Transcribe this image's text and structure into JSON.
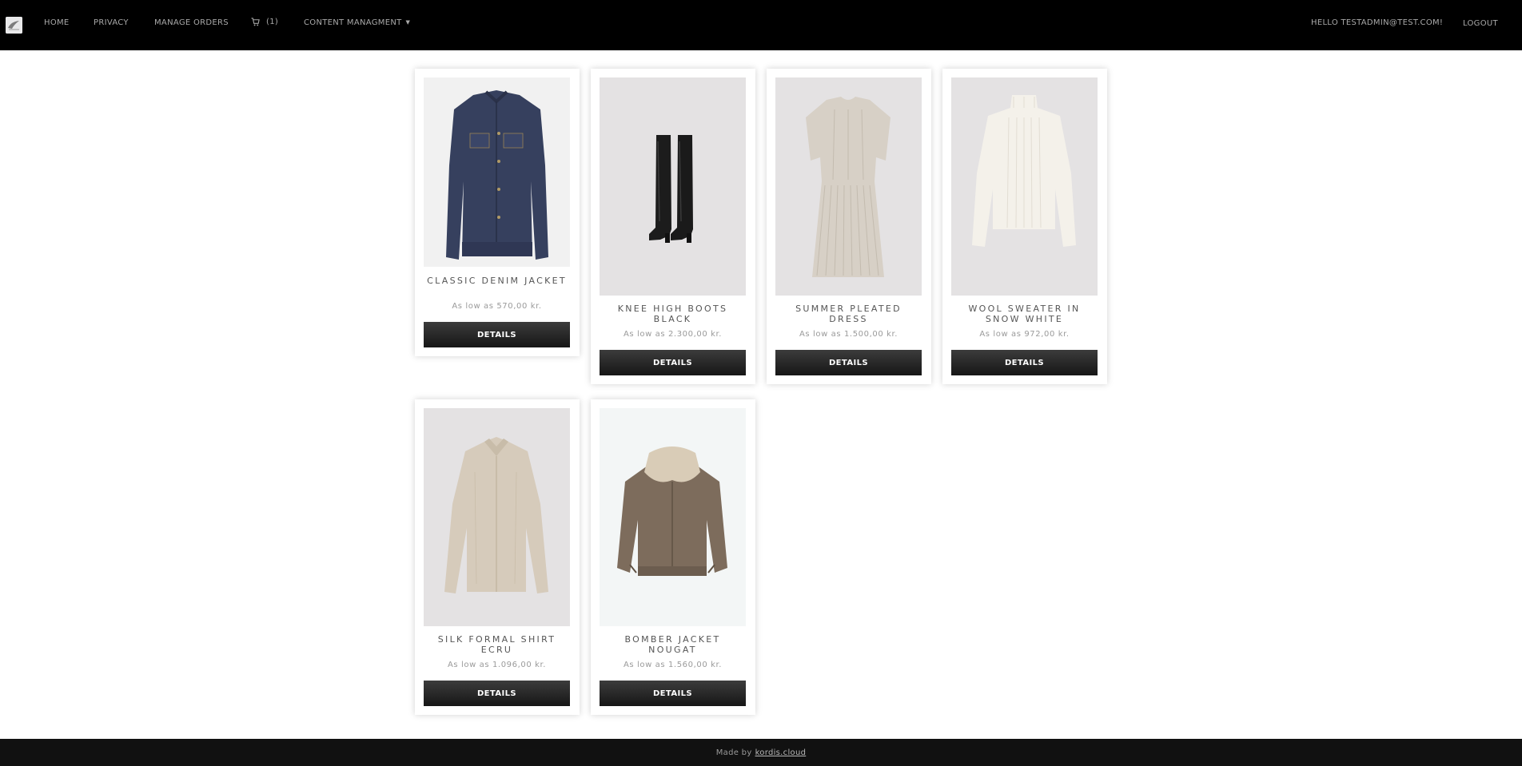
{
  "nav": {
    "logo_icon": "brand-logo-icon",
    "home": "HOME",
    "privacy": "PRIVACY",
    "manage_orders": "MANAGE ORDERS",
    "cart_icon": "cart-icon",
    "cart_count": "(1)",
    "content_management": "CONTENT MANAGMENT",
    "greeting": "HELLO TESTADMIN@TEST.COM!",
    "logout": "LOGOUT"
  },
  "products": [
    {
      "name": "CLASSIC DENIM JACKET",
      "price": "As low as 570,00 kr.",
      "button": "DETAILS",
      "image": "denim-jacket-image"
    },
    {
      "name": "KNEE HIGH BOOTS BLACK",
      "price": "As low as 2.300,00 kr.",
      "button": "DETAILS",
      "image": "knee-high-boots-image"
    },
    {
      "name": "SUMMER PLEATED DRESS",
      "price": "As low as 1.500,00 kr.",
      "button": "DETAILS",
      "image": "pleated-dress-image"
    },
    {
      "name": "WOOL SWEATER IN SNOW WHITE",
      "price": "As low as 972,00 kr.",
      "button": "DETAILS",
      "image": "wool-sweater-image"
    },
    {
      "name": "SILK FORMAL SHIRT ECRU",
      "price": "As low as 1.096,00 kr.",
      "button": "DETAILS",
      "image": "silk-shirt-image"
    },
    {
      "name": "BOMBER JACKET NOUGAT",
      "price": "As low as 1.560,00 kr.",
      "button": "DETAILS",
      "image": "bomber-jacket-image"
    }
  ],
  "footer": {
    "made_by": "Made by",
    "link": "kordis.cloud"
  },
  "colors": {
    "navbar_bg": "#000000",
    "footer_bg": "#111111",
    "button_bg": "#262626",
    "image_bg": "#e4e2e3"
  }
}
